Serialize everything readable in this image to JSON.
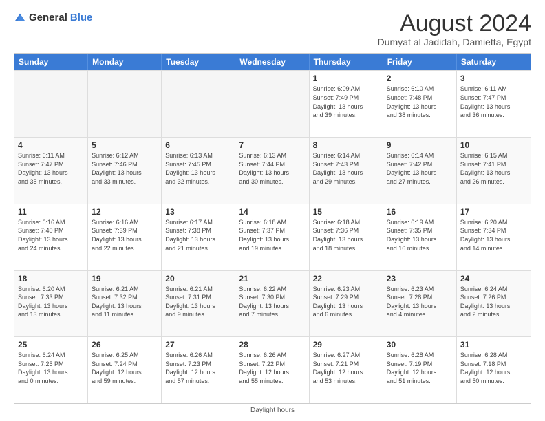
{
  "logo": {
    "general": "General",
    "blue": "Blue"
  },
  "title": {
    "main": "August 2024",
    "sub": "Dumyat al Jadidah, Damietta, Egypt"
  },
  "calendar": {
    "headers": [
      "Sunday",
      "Monday",
      "Tuesday",
      "Wednesday",
      "Thursday",
      "Friday",
      "Saturday"
    ],
    "rows": [
      [
        {
          "day": "",
          "info": "",
          "empty": true
        },
        {
          "day": "",
          "info": "",
          "empty": true
        },
        {
          "day": "",
          "info": "",
          "empty": true
        },
        {
          "day": "",
          "info": "",
          "empty": true
        },
        {
          "day": "1",
          "info": "Sunrise: 6:09 AM\nSunset: 7:49 PM\nDaylight: 13 hours\nand 39 minutes."
        },
        {
          "day": "2",
          "info": "Sunrise: 6:10 AM\nSunset: 7:48 PM\nDaylight: 13 hours\nand 38 minutes."
        },
        {
          "day": "3",
          "info": "Sunrise: 6:11 AM\nSunset: 7:47 PM\nDaylight: 13 hours\nand 36 minutes."
        }
      ],
      [
        {
          "day": "4",
          "info": "Sunrise: 6:11 AM\nSunset: 7:47 PM\nDaylight: 13 hours\nand 35 minutes."
        },
        {
          "day": "5",
          "info": "Sunrise: 6:12 AM\nSunset: 7:46 PM\nDaylight: 13 hours\nand 33 minutes."
        },
        {
          "day": "6",
          "info": "Sunrise: 6:13 AM\nSunset: 7:45 PM\nDaylight: 13 hours\nand 32 minutes."
        },
        {
          "day": "7",
          "info": "Sunrise: 6:13 AM\nSunset: 7:44 PM\nDaylight: 13 hours\nand 30 minutes."
        },
        {
          "day": "8",
          "info": "Sunrise: 6:14 AM\nSunset: 7:43 PM\nDaylight: 13 hours\nand 29 minutes."
        },
        {
          "day": "9",
          "info": "Sunrise: 6:14 AM\nSunset: 7:42 PM\nDaylight: 13 hours\nand 27 minutes."
        },
        {
          "day": "10",
          "info": "Sunrise: 6:15 AM\nSunset: 7:41 PM\nDaylight: 13 hours\nand 26 minutes."
        }
      ],
      [
        {
          "day": "11",
          "info": "Sunrise: 6:16 AM\nSunset: 7:40 PM\nDaylight: 13 hours\nand 24 minutes."
        },
        {
          "day": "12",
          "info": "Sunrise: 6:16 AM\nSunset: 7:39 PM\nDaylight: 13 hours\nand 22 minutes."
        },
        {
          "day": "13",
          "info": "Sunrise: 6:17 AM\nSunset: 7:38 PM\nDaylight: 13 hours\nand 21 minutes."
        },
        {
          "day": "14",
          "info": "Sunrise: 6:18 AM\nSunset: 7:37 PM\nDaylight: 13 hours\nand 19 minutes."
        },
        {
          "day": "15",
          "info": "Sunrise: 6:18 AM\nSunset: 7:36 PM\nDaylight: 13 hours\nand 18 minutes."
        },
        {
          "day": "16",
          "info": "Sunrise: 6:19 AM\nSunset: 7:35 PM\nDaylight: 13 hours\nand 16 minutes."
        },
        {
          "day": "17",
          "info": "Sunrise: 6:20 AM\nSunset: 7:34 PM\nDaylight: 13 hours\nand 14 minutes."
        }
      ],
      [
        {
          "day": "18",
          "info": "Sunrise: 6:20 AM\nSunset: 7:33 PM\nDaylight: 13 hours\nand 13 minutes."
        },
        {
          "day": "19",
          "info": "Sunrise: 6:21 AM\nSunset: 7:32 PM\nDaylight: 13 hours\nand 11 minutes."
        },
        {
          "day": "20",
          "info": "Sunrise: 6:21 AM\nSunset: 7:31 PM\nDaylight: 13 hours\nand 9 minutes."
        },
        {
          "day": "21",
          "info": "Sunrise: 6:22 AM\nSunset: 7:30 PM\nDaylight: 13 hours\nand 7 minutes."
        },
        {
          "day": "22",
          "info": "Sunrise: 6:23 AM\nSunset: 7:29 PM\nDaylight: 13 hours\nand 6 minutes."
        },
        {
          "day": "23",
          "info": "Sunrise: 6:23 AM\nSunset: 7:28 PM\nDaylight: 13 hours\nand 4 minutes."
        },
        {
          "day": "24",
          "info": "Sunrise: 6:24 AM\nSunset: 7:26 PM\nDaylight: 13 hours\nand 2 minutes."
        }
      ],
      [
        {
          "day": "25",
          "info": "Sunrise: 6:24 AM\nSunset: 7:25 PM\nDaylight: 13 hours\nand 0 minutes."
        },
        {
          "day": "26",
          "info": "Sunrise: 6:25 AM\nSunset: 7:24 PM\nDaylight: 12 hours\nand 59 minutes."
        },
        {
          "day": "27",
          "info": "Sunrise: 6:26 AM\nSunset: 7:23 PM\nDaylight: 12 hours\nand 57 minutes."
        },
        {
          "day": "28",
          "info": "Sunrise: 6:26 AM\nSunset: 7:22 PM\nDaylight: 12 hours\nand 55 minutes."
        },
        {
          "day": "29",
          "info": "Sunrise: 6:27 AM\nSunset: 7:21 PM\nDaylight: 12 hours\nand 53 minutes."
        },
        {
          "day": "30",
          "info": "Sunrise: 6:28 AM\nSunset: 7:19 PM\nDaylight: 12 hours\nand 51 minutes."
        },
        {
          "day": "31",
          "info": "Sunrise: 6:28 AM\nSunset: 7:18 PM\nDaylight: 12 hours\nand 50 minutes."
        }
      ]
    ]
  },
  "footer": {
    "note": "Daylight hours"
  }
}
